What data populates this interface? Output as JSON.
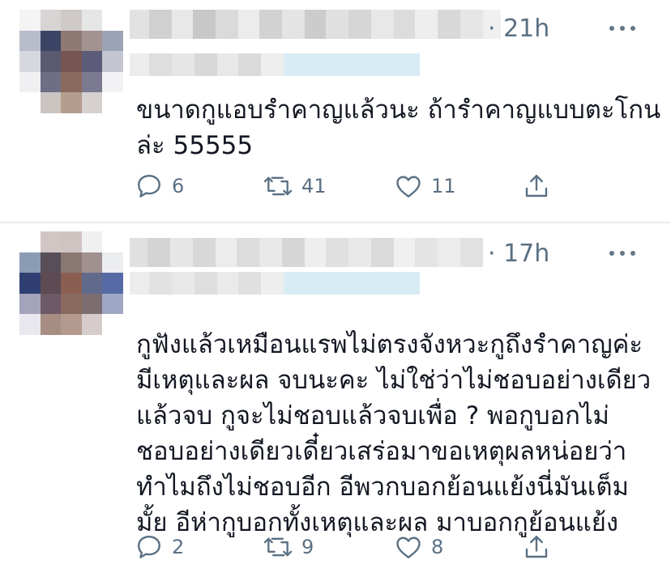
{
  "tweets": [
    {
      "time": "· 21h",
      "lines": [
        "ขนาดกูแอบรำคาญแล้วนะ ถ้ารำคาญแบบตะโกน",
        "ล่ะ 55555"
      ],
      "replies": "6",
      "retweets": "41",
      "likes": "11",
      "icons": [
        "reply-icon",
        "retweet-icon",
        "like-icon",
        "share-icon",
        "more-icon"
      ]
    },
    {
      "time": "· 17h",
      "lines": [
        "กูฟังแล้วเหมือนแรพไม่ตรงจังหวะกูถึงรำคาญค่ะ",
        "มีเหตุและผล จบนะคะ ไม่ใช่ว่าไม่ชอบอย่างเดียว",
        "แล้วจบ กูจะไม่ชอบแล้วจบเพื่อ ? พอกูบอกไม่",
        "ชอบอย่างเดียวเดี๋ยวเสร่อมาขอเหตุผลหน่อยว่า",
        "ทำไมถึงไม่ชอบอีก อีพวกบอกย้อนแย้งนี่มันเต็ม",
        "มั้ย อีห่ากูบอกทั้งเหตุและผล มาบอกกูย้อนแย้ง"
      ],
      "replies": "2",
      "retweets": "9",
      "likes": "8",
      "icons": [
        "reply-icon",
        "retweet-icon",
        "like-icon",
        "share-icon",
        "more-icon"
      ]
    }
  ],
  "colors": {
    "meta_gray": "#5b7083",
    "text": "#141823",
    "divider": "#e6ecf0"
  }
}
